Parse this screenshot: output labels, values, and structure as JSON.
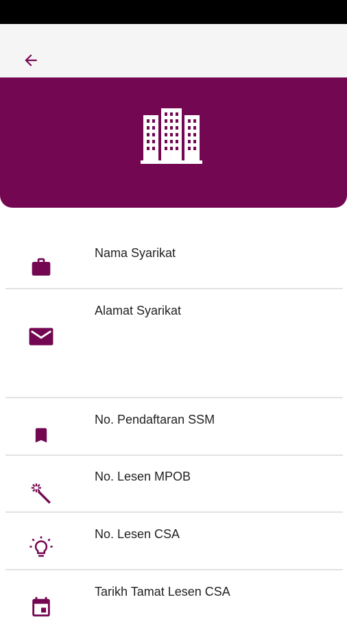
{
  "colors": {
    "brand": "#730751",
    "app_bar_bg": "#f5f5f5",
    "status_bar": "#000000",
    "divider": "#e2e2e2",
    "text": "#222222"
  },
  "app_bar": {
    "back_icon": "arrow-back-icon"
  },
  "hero": {
    "icon": "building-icon"
  },
  "fields": [
    {
      "label": "Nama Syarikat",
      "icon": "briefcase-icon"
    },
    {
      "label": "Alamat Syarikat",
      "icon": "mail-icon"
    },
    {
      "label": "No. Pendaftaran SSM",
      "icon": "bookmark-icon"
    },
    {
      "label": "No. Lesen MPOB",
      "icon": "magic-wand-icon"
    },
    {
      "label": "No. Lesen CSA",
      "icon": "lightbulb-icon"
    },
    {
      "label": "Tarikh Tamat Lesen CSA",
      "icon": "calendar-icon"
    }
  ]
}
